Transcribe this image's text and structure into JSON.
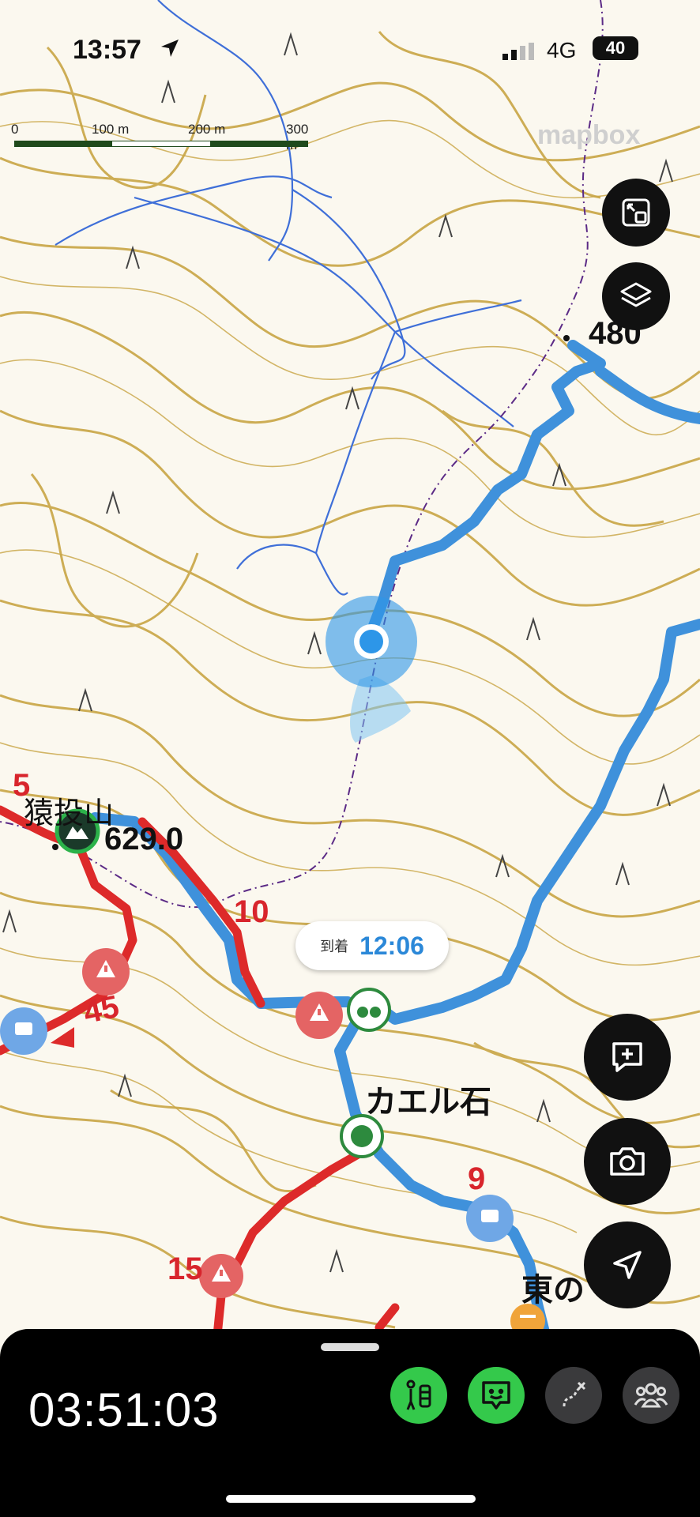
{
  "status_bar": {
    "time": "13:57",
    "network": "4G",
    "battery": "40"
  },
  "scale": {
    "labels": [
      "0",
      "100 m",
      "200 m",
      "300 m"
    ],
    "colors": [
      "#1f4a1c",
      "#ffffff",
      "#1f4a1c"
    ]
  },
  "attribution": "mapbox",
  "map": {
    "labels": {
      "peak_name": "猿投山",
      "elevation": "629.0",
      "contour_480": "480",
      "rock": "カエル石",
      "east": "東の"
    },
    "course_times": [
      "5",
      "10",
      "45",
      "9",
      "15"
    ],
    "colors": {
      "background": "#fbf8ef",
      "contour": "#c9a545",
      "stream": "#3f6fd8",
      "route_blue": "#3f91db",
      "route_red": "#dd2a2a",
      "user_location": "#2d96e8"
    }
  },
  "eta": {
    "label": "到着",
    "time": "12:06"
  },
  "map_buttons": {
    "fit": "fit-bounds-icon",
    "layers": "layers-icon",
    "memo": "add-memo-icon",
    "camera": "camera-icon",
    "locate": "navigation-arrow-icon"
  },
  "bottom_panel": {
    "timer": "03:51:03",
    "actions": [
      {
        "icon": "hiker-icon",
        "state": "on"
      },
      {
        "icon": "chat-face-icon",
        "state": "on"
      },
      {
        "icon": "route-edit-icon",
        "state": "off"
      },
      {
        "icon": "group-icon",
        "state": "off"
      }
    ]
  }
}
